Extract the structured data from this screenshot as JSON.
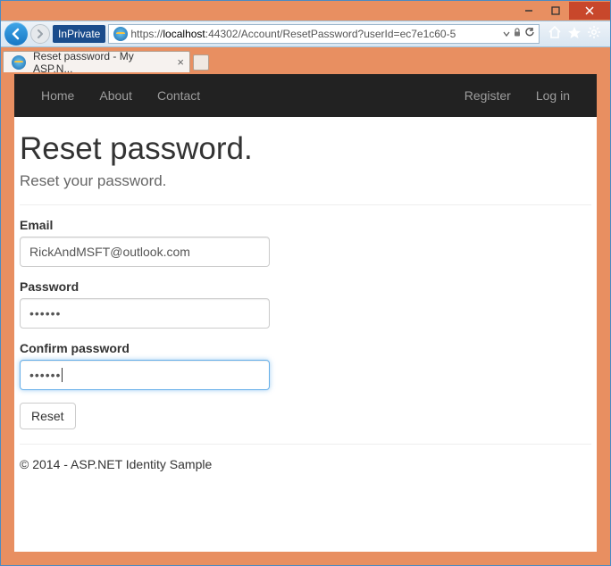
{
  "titlebar": {},
  "toolbar": {
    "inprivate_label": "InPrivate",
    "url_prefix": "https://",
    "url_host": "localhost",
    "url_path": ":44302/Account/ResetPassword?userId=ec7e1c60-5"
  },
  "tab": {
    "title": "Reset password - My ASP.N..."
  },
  "nav": {
    "home": "Home",
    "about": "About",
    "contact": "Contact",
    "register": "Register",
    "login": "Log in"
  },
  "page": {
    "heading": "Reset password.",
    "subtitle": "Reset your password."
  },
  "form": {
    "email_label": "Email",
    "email_value": "RickAndMSFT@outlook.com",
    "password_label": "Password",
    "password_display": "••••••",
    "confirm_label": "Confirm password",
    "confirm_display": "••••••",
    "submit_label": "Reset"
  },
  "footer": {
    "text": "© 2014 - ASP.NET Identity Sample"
  }
}
